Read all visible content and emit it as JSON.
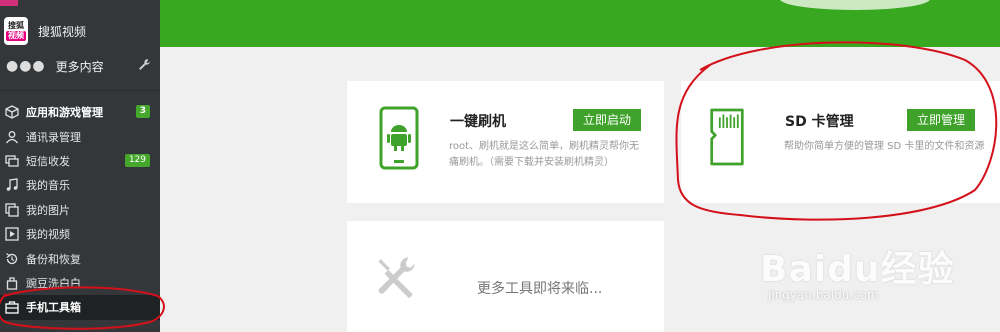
{
  "sidebar": {
    "brand_label": "搜狐视频",
    "brand_logo_text": [
      "搜狐",
      "视频"
    ],
    "more_label": "更多内容",
    "items": [
      {
        "label": "应用和游戏管理",
        "badge": "3",
        "icon": "cube-icon"
      },
      {
        "label": "通讯录管理",
        "badge": "",
        "icon": "contact-icon"
      },
      {
        "label": "短信收发",
        "badge": "129",
        "icon": "message-icon"
      },
      {
        "label": "我的音乐",
        "badge": "",
        "icon": "music-icon"
      },
      {
        "label": "我的图片",
        "badge": "",
        "icon": "picture-icon"
      },
      {
        "label": "我的视频",
        "badge": "",
        "icon": "video-icon"
      },
      {
        "label": "备份和恢复",
        "badge": "",
        "icon": "backup-icon"
      },
      {
        "label": "豌豆洗白白",
        "badge": "",
        "icon": "clean-icon"
      },
      {
        "label": "手机工具箱",
        "badge": "",
        "icon": "toolbox-icon",
        "active": true
      }
    ]
  },
  "cards": {
    "flash": {
      "title": "一键刷机",
      "button": "立即启动",
      "description": "root、刷机就是这么简单，刷机精灵帮你无痛刷机。（需要下载并安装刷机精灵）",
      "icon": "android-phone-icon"
    },
    "sd": {
      "title": "SD 卡管理",
      "button": "立即管理",
      "description": "帮助你简单方便的管理 SD 卡里的文件和资源",
      "icon": "sd-card-icon"
    },
    "more": {
      "text": "更多工具即将来临...",
      "icon": "tools-icon"
    }
  },
  "watermark": {
    "logo": "Baidu经验",
    "url": "jingyan.baidu.com"
  },
  "colors": {
    "accent": "#37a820",
    "button": "#3fa22a",
    "sidebar": "#34373a",
    "annotation": "#d4101a"
  }
}
